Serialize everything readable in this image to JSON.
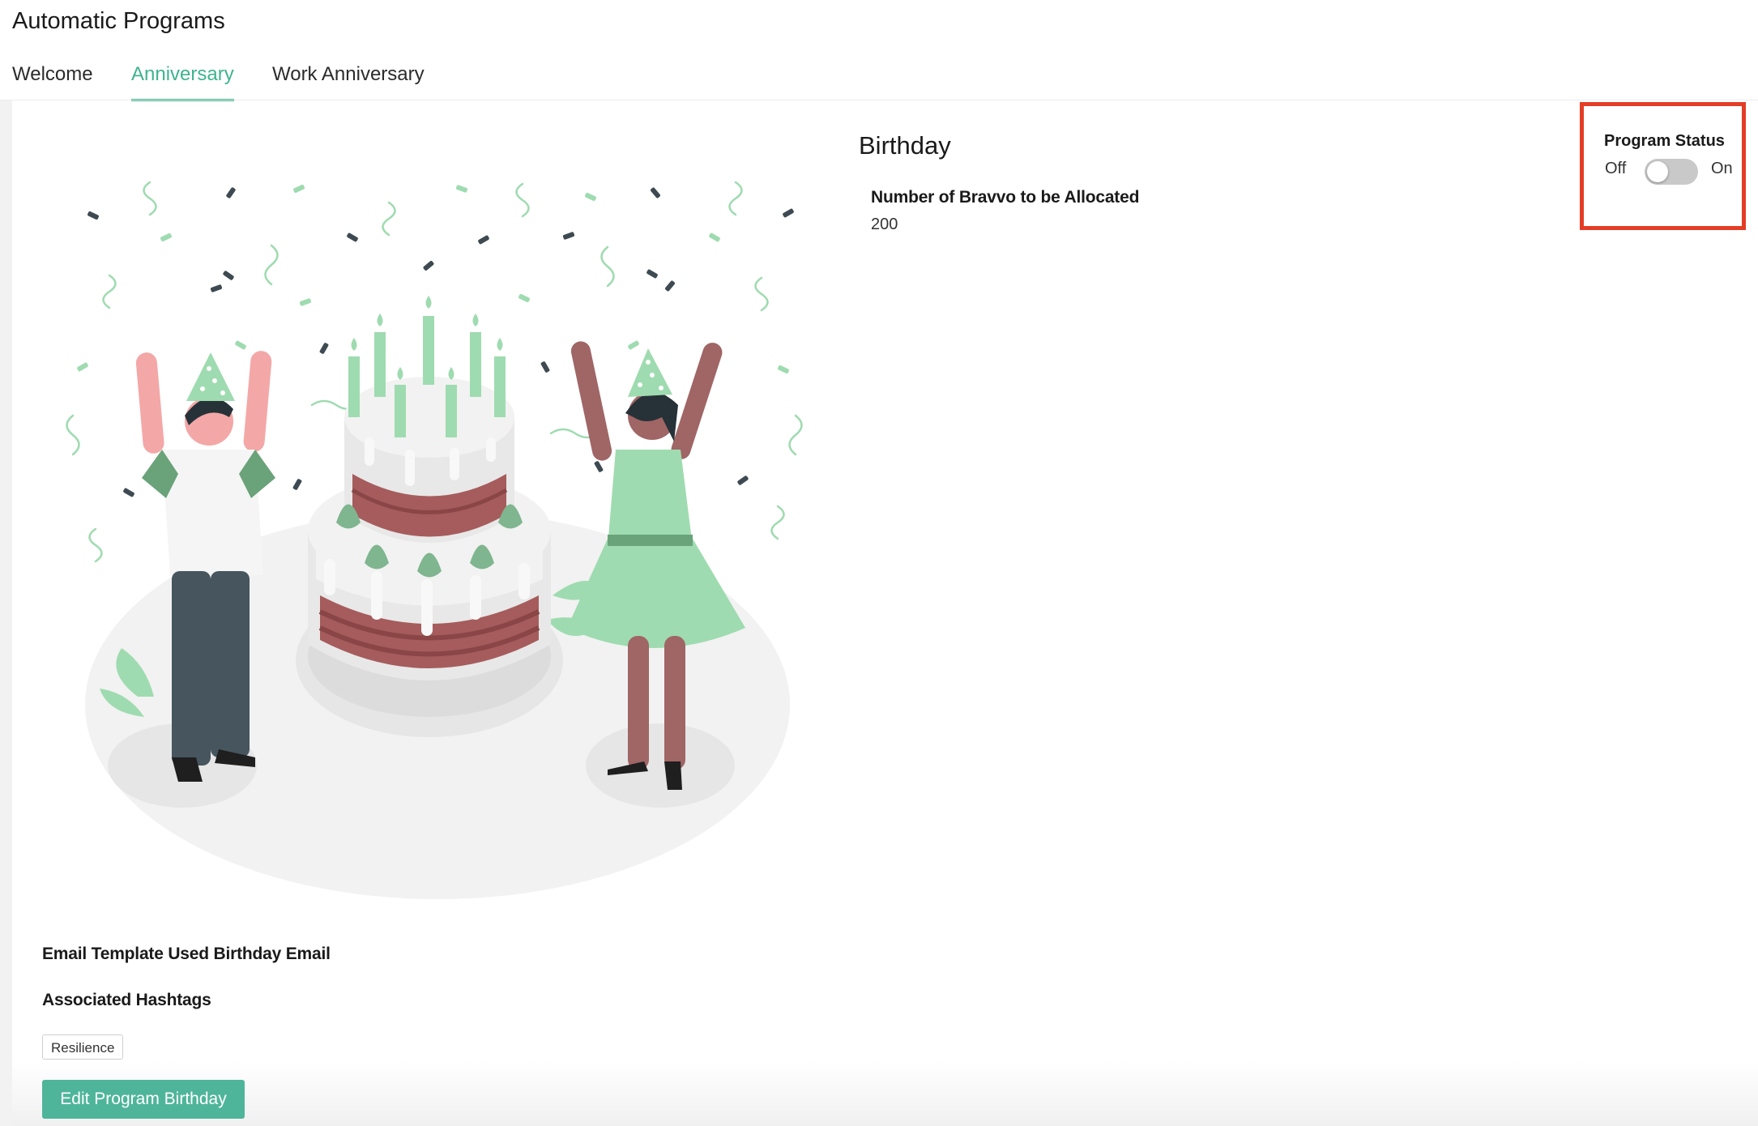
{
  "page": {
    "title": "Automatic Programs"
  },
  "tabs": [
    {
      "label": "Welcome",
      "active": false
    },
    {
      "label": "Anniversary",
      "active": true
    },
    {
      "label": "Work Anniversary",
      "active": false
    }
  ],
  "program": {
    "title": "Birthday",
    "bravvo_label": "Number of Bravvo to be Allocated",
    "bravvo_value": "200",
    "email_template_label": "Email Template Used Birthday Email",
    "hashtags_label": "Associated Hashtags",
    "hashtags": [
      "Resilience"
    ],
    "edit_button_label": "Edit Program Birthday"
  },
  "status": {
    "label": "Program Status",
    "off_label": "Off",
    "on_label": "On",
    "is_on": false
  },
  "colors": {
    "accent": "#3fb38f",
    "button": "#4fb59a",
    "highlight_box": "#e43d26",
    "toggle_off": "#c9c9c9"
  },
  "illustration": {
    "icon": "birthday-party-illustration"
  }
}
